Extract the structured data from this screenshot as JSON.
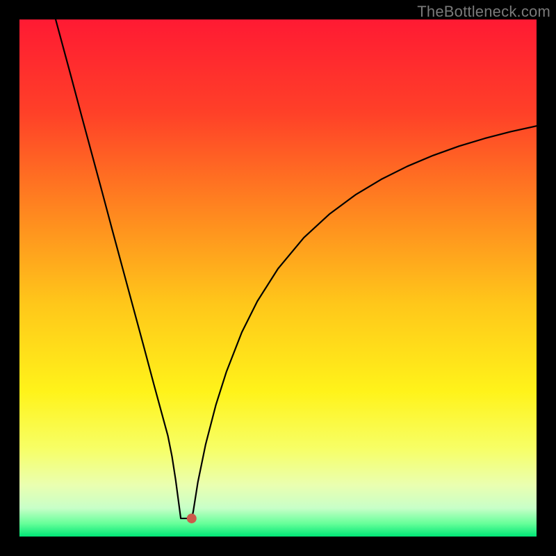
{
  "watermark": "TheBottleneck.com",
  "chart_data": {
    "type": "line",
    "title": "",
    "xlabel": "",
    "ylabel": "",
    "xlim": [
      0,
      100
    ],
    "ylim": [
      0,
      100
    ],
    "grid": false,
    "legend": false,
    "background_gradient_stops": [
      {
        "offset": 0.0,
        "color": "#ff1a33"
      },
      {
        "offset": 0.18,
        "color": "#ff4028"
      },
      {
        "offset": 0.38,
        "color": "#ff8a1f"
      },
      {
        "offset": 0.55,
        "color": "#ffc71a"
      },
      {
        "offset": 0.72,
        "color": "#fff31a"
      },
      {
        "offset": 0.83,
        "color": "#f7ff66"
      },
      {
        "offset": 0.9,
        "color": "#eaffb0"
      },
      {
        "offset": 0.945,
        "color": "#c8ffc8"
      },
      {
        "offset": 0.975,
        "color": "#66ff99"
      },
      {
        "offset": 1.0,
        "color": "#00e676"
      }
    ],
    "series": [
      {
        "name": "bottleneck-curve",
        "color": "#000000",
        "x": [
          7.0,
          8.0,
          10.0,
          12.0,
          14.0,
          16.0,
          18.0,
          20.0,
          22.0,
          24.0,
          26.0,
          27.5,
          28.7,
          29.5,
          30.2,
          30.8,
          31.2,
          32.5,
          33.3,
          33.6,
          34.5,
          36.0,
          38.0,
          40.0,
          43.0,
          46.0,
          50.0,
          55.0,
          60.0,
          65.0,
          70.0,
          75.0,
          80.0,
          85.0,
          90.0,
          95.0,
          100.0
        ],
        "y": [
          100.0,
          96.3,
          88.9,
          81.4,
          74.0,
          66.6,
          59.1,
          51.7,
          44.3,
          36.9,
          29.4,
          23.9,
          19.5,
          15.5,
          11.0,
          6.5,
          3.5,
          3.5,
          3.5,
          4.8,
          10.5,
          17.8,
          25.5,
          31.8,
          39.5,
          45.5,
          51.8,
          57.8,
          62.4,
          66.1,
          69.1,
          71.6,
          73.7,
          75.5,
          77.0,
          78.3,
          79.4
        ]
      }
    ],
    "marker": {
      "name": "optimal-point",
      "x": 33.3,
      "y": 3.5,
      "color": "#cc5a4a",
      "radius_px": 7
    },
    "flat_bottom": {
      "x_start": 31.2,
      "x_end": 33.6,
      "y": 3.5
    }
  }
}
